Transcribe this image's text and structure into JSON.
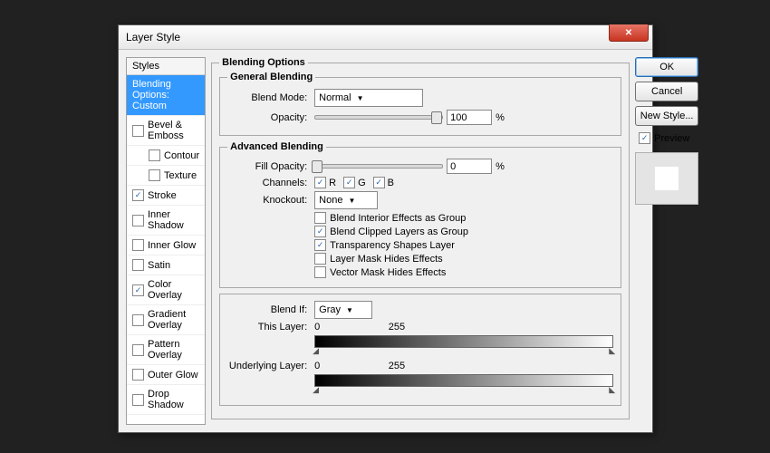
{
  "title": "Layer Style",
  "styles": {
    "header": "Styles",
    "items": [
      {
        "label": "Blending Options: Custom",
        "selected": true,
        "hasCheckbox": false
      },
      {
        "label": "Bevel & Emboss",
        "checked": false
      },
      {
        "label": "Contour",
        "checked": false,
        "indent": true
      },
      {
        "label": "Texture",
        "checked": false,
        "indent": true
      },
      {
        "label": "Stroke",
        "checked": true
      },
      {
        "label": "Inner Shadow",
        "checked": false
      },
      {
        "label": "Inner Glow",
        "checked": false
      },
      {
        "label": "Satin",
        "checked": false
      },
      {
        "label": "Color Overlay",
        "checked": true
      },
      {
        "label": "Gradient Overlay",
        "checked": false
      },
      {
        "label": "Pattern Overlay",
        "checked": false
      },
      {
        "label": "Outer Glow",
        "checked": false
      },
      {
        "label": "Drop Shadow",
        "checked": false
      }
    ]
  },
  "blending": {
    "panel_label": "Blending Options",
    "general": {
      "legend": "General Blending",
      "blend_mode_label": "Blend Mode:",
      "blend_mode_value": "Normal",
      "opacity_label": "Opacity:",
      "opacity_value": "100",
      "opacity_unit": "%"
    },
    "advanced": {
      "legend": "Advanced Blending",
      "fill_opacity_label": "Fill Opacity:",
      "fill_opacity_value": "0",
      "fill_opacity_unit": "%",
      "channels_label": "Channels:",
      "channels": [
        {
          "label": "R",
          "checked": true
        },
        {
          "label": "G",
          "checked": true
        },
        {
          "label": "B",
          "checked": true
        }
      ],
      "knockout_label": "Knockout:",
      "knockout_value": "None",
      "options": [
        {
          "label": "Blend Interior Effects as Group",
          "checked": false
        },
        {
          "label": "Blend Clipped Layers as Group",
          "checked": true
        },
        {
          "label": "Transparency Shapes Layer",
          "checked": true
        },
        {
          "label": "Layer Mask Hides Effects",
          "checked": false
        },
        {
          "label": "Vector Mask Hides Effects",
          "checked": false
        }
      ]
    },
    "blendif": {
      "label": "Blend If:",
      "value": "Gray",
      "this_layer_label": "This Layer:",
      "this_layer_vals": [
        "0",
        "255"
      ],
      "underlying_label": "Underlying Layer:",
      "underlying_vals": [
        "0",
        "255"
      ]
    }
  },
  "side": {
    "ok": "OK",
    "cancel": "Cancel",
    "new_style": "New Style...",
    "preview": "Preview"
  }
}
